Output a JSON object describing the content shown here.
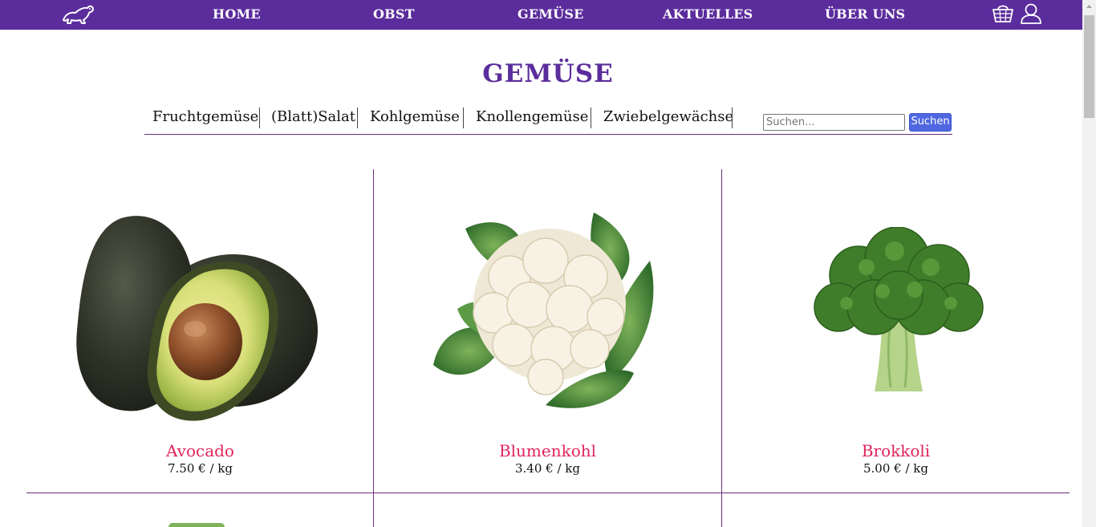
{
  "nav": {
    "logo_icon": "ferret-logo-icon",
    "links": [
      "HOME",
      "OBST",
      "GEMÜSE",
      "AKTUELLES",
      "ÜBER UNS"
    ],
    "cart_icon": "basket-icon",
    "user_icon": "user-icon"
  },
  "page": {
    "title": "GEMÜSE"
  },
  "subnav": {
    "categories": [
      "Fruchtgemüse",
      "(Blatt)Salat",
      "Kohlgemüse",
      "Knollengemüse",
      "Zwiebelgewächse"
    ],
    "search_placeholder": "Suchen...",
    "search_button": "Suchen"
  },
  "products": [
    {
      "name": "Avocado",
      "price": "7.50 € / kg",
      "image": "avocado-image"
    },
    {
      "name": "Blumenkohl",
      "price": "3.40 € / kg",
      "image": "cauliflower-image"
    },
    {
      "name": "Brokkoli",
      "price": "5.00 € / kg",
      "image": "broccoli-image"
    }
  ],
  "colors": {
    "brand": "#5b2d9c",
    "product_name": "#e0245e",
    "divider": "#6b2f7a",
    "search_button": "#4f67e0"
  }
}
